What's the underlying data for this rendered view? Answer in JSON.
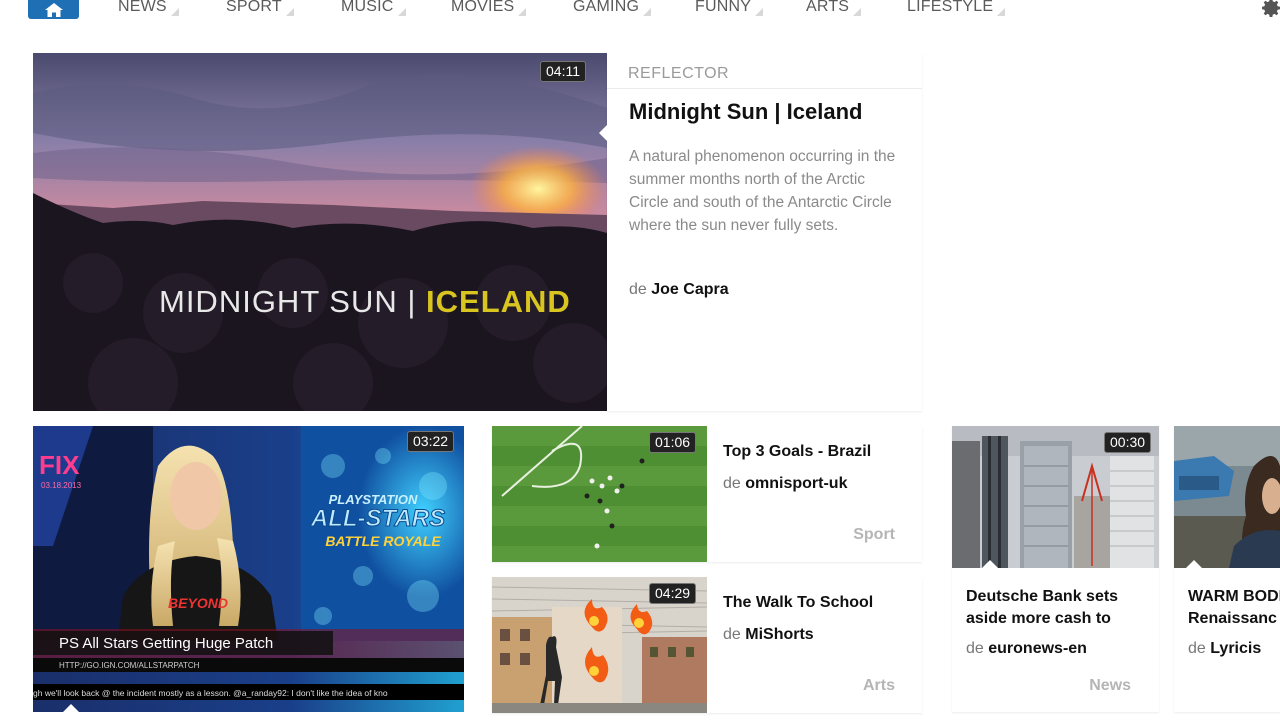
{
  "nav": {
    "items": [
      "NEWS",
      "SPORT",
      "MUSIC",
      "MOVIES",
      "GAMING",
      "FUNNY",
      "ARTS",
      "LIFESTYLE"
    ]
  },
  "featured": {
    "duration": "04:11",
    "source": "REFLECTOR",
    "title": "Midnight Sun | Iceland",
    "description": "A natural phenomenon occurring in the summer months north of the Arctic Circle and south of the Antarctic Circle where the sun never fully sets.",
    "by": "de",
    "author": "Joe Capra",
    "overlay_left": "MIDNIGHT SUN | ",
    "overlay_right": "ICELAND"
  },
  "big_video": {
    "duration": "03:22",
    "show": "FIX",
    "show_date": "03.18.2013",
    "game_title_1": "PLAYSTATION",
    "game_title_2": "ALL-STARS",
    "game_title_3": "BATTLE ROYALE",
    "shirt": "BEYOND",
    "headline": "PS All Stars Getting Huge Patch",
    "url": "HTTP://GO.IGN.COM/ALLSTARPATCH",
    "ticker": "gh we'll look back @ the incident mostly as a lesson.    @a_randay92: I don't like the idea of kno"
  },
  "videos": [
    {
      "duration": "01:06",
      "title": "Top 3 Goals - Brazil",
      "by": "de",
      "author": "omnisport-uk",
      "category": "Sport"
    },
    {
      "duration": "04:29",
      "title": "The Walk To School",
      "by": "de",
      "author": "MiShorts",
      "category": "Arts"
    },
    {
      "duration": "00:30",
      "title": "Deutsche Bank sets aside more cash to",
      "by": "de",
      "author": "euronews-en",
      "category": "News"
    },
    {
      "duration": "",
      "title": "WARM BODI Renaissanc",
      "by": "de",
      "author": "Lyricis",
      "category": ""
    }
  ],
  "colors": {
    "home_button": "#1f6fb5",
    "overlay_accent": "#d9c520",
    "fix_pink": "#ff3c8e"
  }
}
